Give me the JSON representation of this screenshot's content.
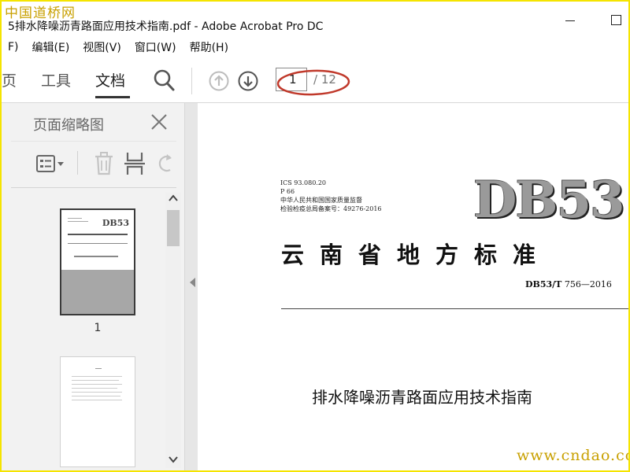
{
  "watermark": {
    "top": "中国道桥网",
    "bottom": "www.cndao.com"
  },
  "window": {
    "title": "5排水降噪沥青路面应用技术指南.pdf - Adobe Acrobat Pro DC"
  },
  "menu": [
    {
      "label": "F)"
    },
    {
      "label": "编辑(E)"
    },
    {
      "label": "视图(V)"
    },
    {
      "label": "窗口(W)"
    },
    {
      "label": "帮助(H)"
    }
  ],
  "toolbar": {
    "tabs": [
      {
        "label": "页"
      },
      {
        "label": "工具"
      },
      {
        "label": "文档"
      }
    ],
    "active_tab": "文档",
    "page_current": "1",
    "page_total": "/ 12",
    "highlight_color": "#c0392b"
  },
  "thumbnail_panel": {
    "title": "页面缩略图",
    "thumbnails": [
      {
        "label": "1",
        "code": "DB53"
      },
      {
        "label": ""
      }
    ]
  },
  "document": {
    "meta_lines": [
      "ICS 93.080.20",
      "P 66",
      "中华人民共和国国家质量监督",
      "检验检疫总局备案号：49276-2016"
    ],
    "standard_code": "DB53",
    "standard_name": "云南省地方标准",
    "standard_number_prefix": "DB53/T",
    "standard_number": "756—2016",
    "title": "排水降噪沥青路面应用技术指南"
  },
  "colors": {
    "frame": "#f5e400",
    "watermark": "#c8a000",
    "panel_bg": "#f2f2f2"
  }
}
